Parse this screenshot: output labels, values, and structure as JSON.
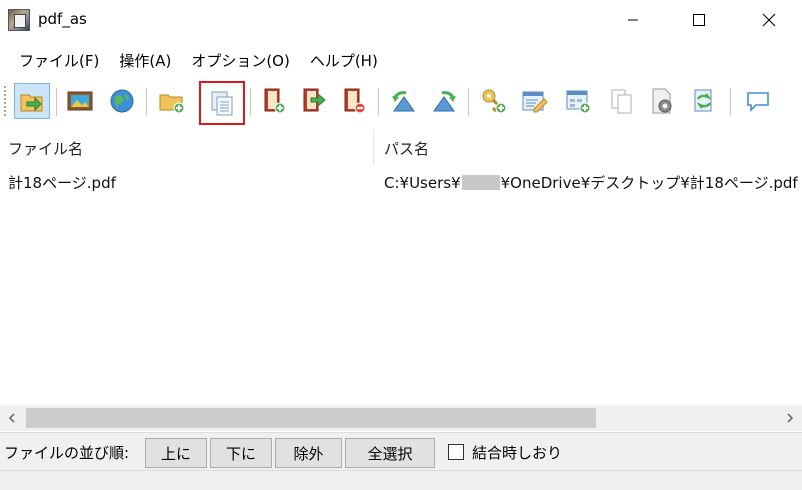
{
  "window": {
    "title": "pdf_as"
  },
  "menu": [
    {
      "label": "ファイル(F)"
    },
    {
      "label": "操作(A)"
    },
    {
      "label": "オプション(O)"
    },
    {
      "label": "ヘルプ(H)"
    }
  ],
  "toolbar": {
    "buttons": [
      {
        "icon": "open-folder-arrow-icon"
      },
      {
        "icon": "image-icon"
      },
      {
        "icon": "globe-icon"
      },
      {
        "icon": "folder-add-icon"
      },
      {
        "icon": "copy-pages-icon"
      },
      {
        "icon": "doc-add-icon"
      },
      {
        "icon": "doc-arrow-icon"
      },
      {
        "icon": "doc-remove-icon"
      },
      {
        "icon": "rotate-left-icon"
      },
      {
        "icon": "rotate-right-icon"
      },
      {
        "icon": "key-add-icon"
      },
      {
        "icon": "edit-icon"
      },
      {
        "icon": "window-add-icon"
      },
      {
        "icon": "pages-icon"
      },
      {
        "icon": "settings-doc-icon"
      },
      {
        "icon": "refresh-doc-icon"
      },
      {
        "icon": "comment-icon"
      }
    ]
  },
  "list": {
    "columns": [
      {
        "label": "ファイル名"
      },
      {
        "label": "パス名"
      }
    ],
    "rows": [
      {
        "filename": "計18ページ.pdf",
        "path_prefix": "C:¥Users¥",
        "path_suffix": "¥OneDrive¥デスクトップ¥計18ページ.pdf"
      }
    ]
  },
  "bottom": {
    "order_label": "ファイルの並び順:",
    "up_label": "上に",
    "down_label": "下に",
    "exclude_label": "除外",
    "select_all_label": "全選択",
    "bookmark_label": "結合時しおり"
  },
  "colors": {
    "highlight": "#e0161e",
    "active_bg": "#cce4f7"
  }
}
